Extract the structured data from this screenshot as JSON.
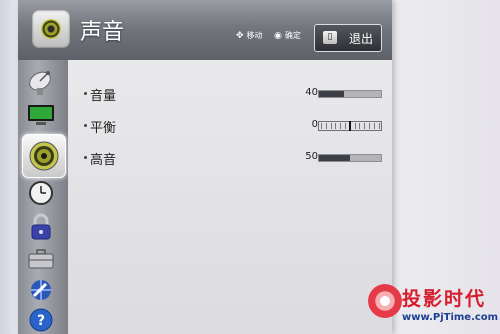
{
  "header": {
    "title": "声音",
    "hint_move_icon": "dpad-icon",
    "hint_move": "移动",
    "hint_ok_icon": "ok-icon",
    "hint_ok": "确定",
    "exit_key": "",
    "exit_label": "退出"
  },
  "sidebar": {
    "items": [
      {
        "icon": "satellite-dish-icon",
        "active": false
      },
      {
        "icon": "monitor-icon",
        "active": false
      },
      {
        "icon": "speaker-icon",
        "active": true
      },
      {
        "icon": "clock-icon",
        "active": false
      },
      {
        "icon": "lock-icon",
        "active": false
      },
      {
        "icon": "briefcase-icon",
        "active": false
      },
      {
        "icon": "network-icon",
        "active": false
      },
      {
        "icon": "help-icon",
        "active": false
      }
    ]
  },
  "settings": [
    {
      "label": "音量",
      "value": "40",
      "level": 0.4,
      "type": "bar"
    },
    {
      "label": "平衡",
      "value": "0",
      "level": 0.5,
      "type": "balance"
    },
    {
      "label": "高音",
      "value": "50",
      "level": 0.5,
      "type": "bar"
    }
  ],
  "watermark": {
    "title": "投影时代",
    "url": "www.PjTime.com"
  },
  "colors": {
    "header_bg": "#6a6c74",
    "content_bg": "#e4e4e8",
    "bar_fill": "#3d3f46",
    "watermark_red": "#d61d2c",
    "watermark_blue": "#1d3f94"
  }
}
